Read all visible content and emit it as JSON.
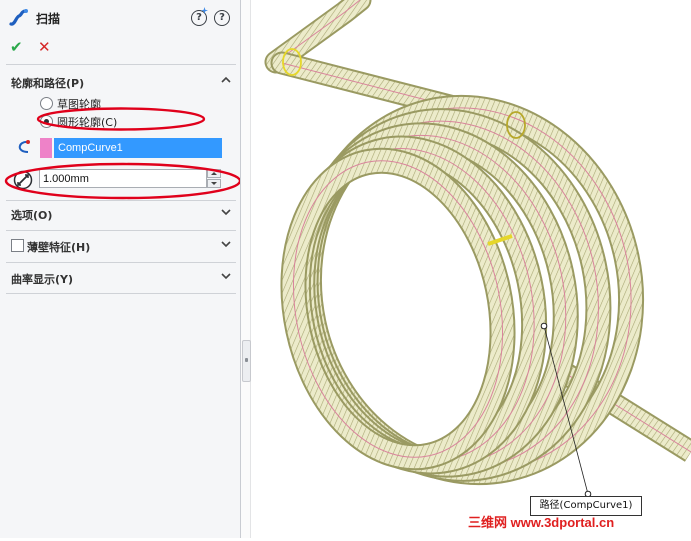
{
  "panel": {
    "title": "扫描",
    "help_symbol": "?",
    "ok_symbol": "✔",
    "cancel_symbol": "✕",
    "sections": {
      "profile_path": {
        "header": "轮廓和路径(P)",
        "expanded": true,
        "radio_options": [
          {
            "label": "草图轮廓",
            "selected": false
          },
          {
            "label": "圆形轮廓(C)",
            "selected": true
          }
        ],
        "path_value": "CompCurve1",
        "path_icon": "sweep-path-icon",
        "diameter_value": "1.000mm",
        "diameter_icon": "diameter-icon"
      },
      "options": {
        "header": "选项(O)",
        "expanded": false
      },
      "thin_feature": {
        "header": "薄壁特征(H)",
        "checked": false,
        "expanded": false
      },
      "curvature": {
        "header": "曲率显示(Y)",
        "expanded": false
      }
    }
  },
  "viewport": {
    "callout_label": "路径(CompCurve1)"
  },
  "watermark": "三维网 www.3dportal.cn",
  "colors": {
    "accent_blue": "#3399ff",
    "path_swatch": "#ee82c8",
    "highlight_red": "#e0001b",
    "ok_green": "#2aa84a",
    "cancel_red": "#d62828",
    "spring_fill": "#e8e7c2",
    "spring_edge": "#9a9a62",
    "spring_inner_line": "#d9849c"
  }
}
